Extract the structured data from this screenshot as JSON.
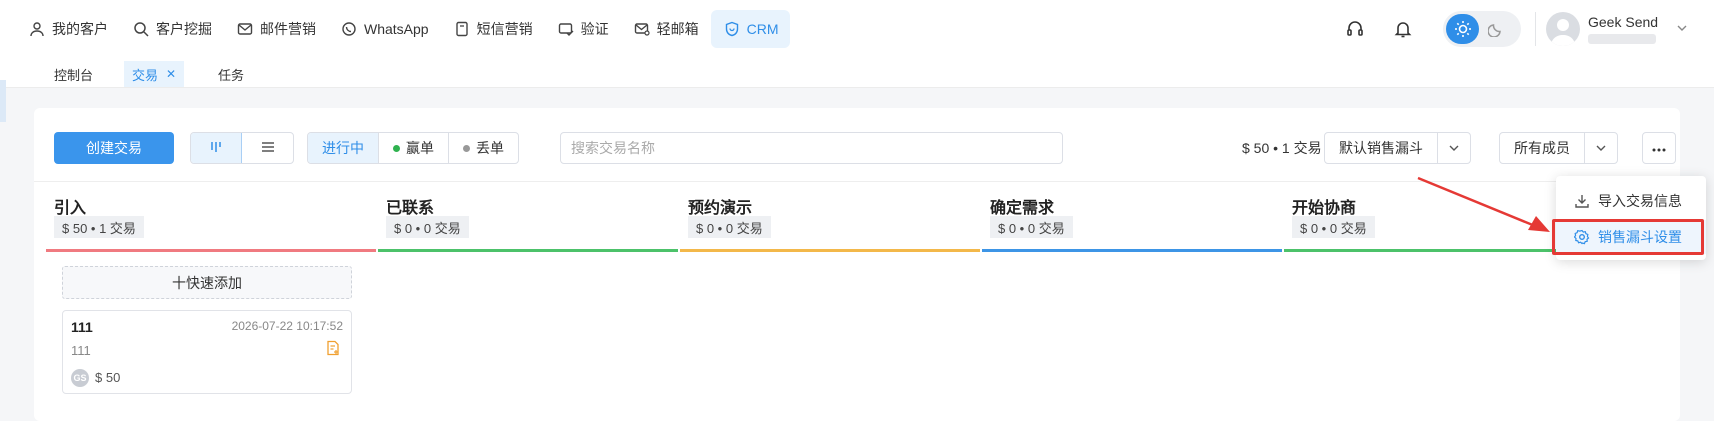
{
  "nav": {
    "items": [
      {
        "label": "我的客户",
        "icon": "user-icon"
      },
      {
        "label": "客户挖掘",
        "icon": "search-icon"
      },
      {
        "label": "邮件营销",
        "icon": "mail-icon"
      },
      {
        "label": "WhatsApp",
        "icon": "whatsapp-icon"
      },
      {
        "label": "短信营销",
        "icon": "sms-icon"
      },
      {
        "label": "验证",
        "icon": "verify-icon"
      },
      {
        "label": "轻邮箱",
        "icon": "light-mail-icon"
      },
      {
        "label": "CRM",
        "icon": "crm-icon"
      }
    ],
    "active": "CRM"
  },
  "user": {
    "name": "Geek Send"
  },
  "tabs": [
    {
      "label": "控制台"
    },
    {
      "label": "交易",
      "closable": true
    },
    {
      "label": "任务"
    }
  ],
  "toolbar": {
    "create_label": "创建交易",
    "status": {
      "in_progress": "进行中",
      "won": "赢单",
      "lost": "丢单"
    },
    "search_placeholder": "搜索交易名称",
    "summary": "$ 50 • 1 交易",
    "pipeline_select": "默认销售漏斗",
    "member_select": "所有成员"
  },
  "columns": [
    {
      "title": "引入",
      "summary": "$ 50  • 1 交易",
      "color": "#f07a80"
    },
    {
      "title": "已联系",
      "summary": "$ 0   • 0 交易",
      "color": "#4cc26a"
    },
    {
      "title": "预约演示",
      "summary": "$ 0   • 0 交易",
      "color": "#f3b84a"
    },
    {
      "title": "确定需求",
      "summary": "$ 0   • 0 交易",
      "color": "#3d95e6"
    },
    {
      "title": "开始协商",
      "summary": "$ 0   • 0 交易",
      "color": "#4cc26a"
    }
  ],
  "quick_add": "十快速添加",
  "deal": {
    "name": "111",
    "time": "2026-07-22 10:17:52",
    "desc": "111",
    "owner_initials": "GS",
    "amount": "$ 50"
  },
  "dropdown": {
    "items": [
      {
        "label": "导入交易信息",
        "icon": "download-icon"
      },
      {
        "label": "销售漏斗设置",
        "icon": "gear-icon"
      }
    ]
  },
  "colors": {
    "accent": "#3a95ec",
    "annotation": "#e53935"
  }
}
